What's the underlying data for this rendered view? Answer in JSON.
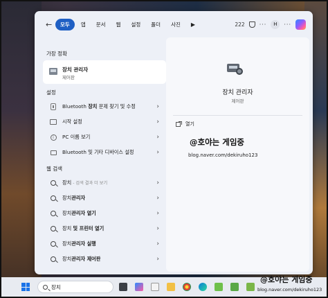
{
  "search_tabs": {
    "back": "←",
    "items": [
      "모두",
      "앱",
      "문서",
      "웹",
      "설정",
      "폴더",
      "사진"
    ],
    "play": "▶",
    "count": "222",
    "user": "H",
    "more": "···"
  },
  "best_match": {
    "heading": "가장 정확",
    "title": "장치 관리자",
    "subtitle": "제어판"
  },
  "settings": {
    "heading": "설정",
    "items": [
      {
        "pre": "Bluetooth ",
        "bold": "장치",
        "post": " 문제 찾기 및 수정"
      },
      {
        "pre": "시작 설정",
        "bold": "",
        "post": ""
      },
      {
        "pre": "PC 이름 보기",
        "bold": "",
        "post": ""
      },
      {
        "pre": "Bluetooth 및 기타 디바이스 설정",
        "bold": "",
        "post": ""
      }
    ]
  },
  "web": {
    "heading": "웹 검색",
    "items": [
      {
        "pre": "장치",
        "bold": "",
        "hint": " - 검색 결과 더 보기"
      },
      {
        "pre": "장치",
        "bold": "관리자",
        "hint": ""
      },
      {
        "pre": "장치",
        "bold": "관리자 열기",
        "hint": ""
      },
      {
        "pre": "장치 ",
        "bold": "및 프린터 열기",
        "hint": ""
      },
      {
        "pre": "장치",
        "bold": "관리자 실행",
        "hint": ""
      },
      {
        "pre": "장치",
        "bold": "관리자 제어판",
        "hint": ""
      }
    ]
  },
  "detail": {
    "title": "장치 관리자",
    "subtitle": "제어판",
    "open_label": "열기"
  },
  "watermark": {
    "main": "@호야는 게임중",
    "sub": "blog.naver.com/dekiruho123"
  },
  "taskbar": {
    "search_text": "장치"
  },
  "colors": {
    "accent": "#1f5fc4",
    "panel": "#edf0f7"
  }
}
